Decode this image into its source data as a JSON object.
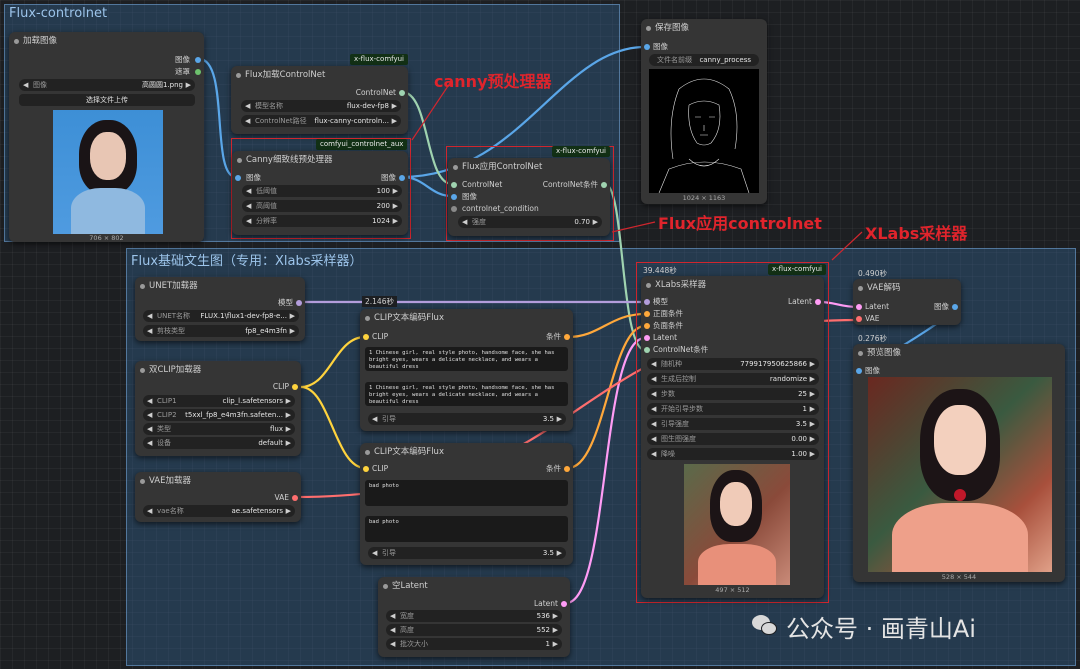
{
  "groups": {
    "controlnet": "Flux-controlnet",
    "basic": "Flux基础文生图（专用：Xlabs采样器）"
  },
  "annotations": {
    "canny": "canny预处理器",
    "apply": "Flux应用controlnet",
    "xlabs": "XLabs采样器"
  },
  "load_image": {
    "title": "加载图像",
    "out_image": "图像",
    "out_mask": "遮罩",
    "image_label": "图像",
    "image_value": "高圆圆1.png",
    "upload_label": "选择文件上传",
    "dims": "706 × 802"
  },
  "load_cn": {
    "tag": "x-flux-comfyui",
    "title": "Flux加载ControlNet",
    "out": "ControlNet",
    "model_label": "模型名称",
    "model_value": "flux-dev-fp8",
    "path_label": "ControlNet路径",
    "path_value": "flux-canny-controln..."
  },
  "canny": {
    "tag": "comfyui_controlnet_aux",
    "title": "Canny细致线预处理器",
    "in": "图像",
    "out": "图像",
    "low_label": "低阈值",
    "low_value": "100",
    "high_label": "高阈值",
    "high_value": "200",
    "res_label": "分辨率",
    "res_value": "1024"
  },
  "apply_cn": {
    "tag": "x-flux-comfyui",
    "title": "Flux应用ControlNet",
    "in_cn": "ControlNet",
    "in_img": "图像",
    "in_cond": "controlnet_condition",
    "out": "ControlNet条件",
    "str_label": "强度",
    "str_value": "0.70"
  },
  "save_image": {
    "title": "保存图像",
    "in": "图像",
    "prefix_label": "文件名前缀",
    "prefix_value": "canny_process",
    "dims": "1024 × 1163"
  },
  "unet": {
    "title": "UNET加载器",
    "out": "模型",
    "name_label": "UNET名称",
    "name_value": "FLUX.1\\flux1-dev-fp8-e...",
    "dtype_label": "剪枝类型",
    "dtype_value": "fp8_e4m3fn",
    "timer": "2.146秒"
  },
  "dual_clip": {
    "title": "双CLIP加载器",
    "out": "CLIP",
    "clip1_label": "CLIP1",
    "clip1_value": "clip_l.safetensors",
    "clip2_label": "CLIP2",
    "clip2_value": "t5xxl_fp8_e4m3fn.safeten...",
    "type_label": "类型",
    "type_value": "flux",
    "device_label": "设备",
    "device_value": "default"
  },
  "vae_loader": {
    "title": "VAE加载器",
    "out": "VAE",
    "name_label": "vae名称",
    "name_value": "ae.safetensors"
  },
  "clip_pos": {
    "title": "CLIP文本编码Flux",
    "in": "CLIP",
    "out": "条件",
    "text1": "1 Chinese girl, real style photo, handsome face, she has bright eyes, wears a delicate necklace, and wears a beautiful dress",
    "text2": "1 Chinese girl, real style photo, handsome face, she has bright eyes, wears a delicate necklace, and wears a beautiful dress",
    "guid_label": "引导",
    "guid_value": "3.5"
  },
  "clip_neg": {
    "title": "CLIP文本编码Flux",
    "in": "CLIP",
    "out": "条件",
    "text1": "bad photo",
    "text2": "bad photo",
    "guid_label": "引导",
    "guid_value": "3.5"
  },
  "empty_latent": {
    "title": "空Latent",
    "out": "Latent",
    "w_label": "宽度",
    "w_value": "536",
    "h_label": "高度",
    "h_value": "552",
    "b_label": "批次大小",
    "b_value": "1"
  },
  "sampler": {
    "timer": "39.448秒",
    "tag": "x-flux-comfyui",
    "title": "XLabs采样器",
    "in_model": "模型",
    "in_pos": "正面条件",
    "in_neg": "负面条件",
    "in_latent": "Latent",
    "in_cn": "ControlNet条件",
    "out": "Latent",
    "seed_label": "随机种",
    "seed_value": "779917950625866",
    "ctrl_label": "生成后控制",
    "ctrl_value": "randomize",
    "steps_label": "步数",
    "steps_value": "25",
    "start_label": "开始引导步数",
    "start_value": "1",
    "guid_label": "引导强度",
    "guid_value": "3.5",
    "i2i_label": "图生图强度",
    "i2i_value": "0.00",
    "denoise_label": "降噪",
    "denoise_value": "1.00",
    "dims": "497 × 512"
  },
  "vae_decode": {
    "timer": "0.490秒",
    "title": "VAE解码",
    "in_latent": "Latent",
    "in_vae": "VAE",
    "out": "图像"
  },
  "preview": {
    "timer": "0.276秒",
    "title": "预览图像",
    "in": "图像",
    "dims": "528 × 544"
  },
  "watermark": "公众号 · 画青山Ai",
  "colors": {
    "image": "#5aa6e8",
    "mask": "#6dc16d",
    "model": "#b39ddb",
    "clip": "#ffd33d",
    "cond": "#ffa83b",
    "latent": "#ff9cf5",
    "vae": "#ff6e6e",
    "controlnet": "#9fd3b0",
    "annotation": "#e0242c"
  }
}
